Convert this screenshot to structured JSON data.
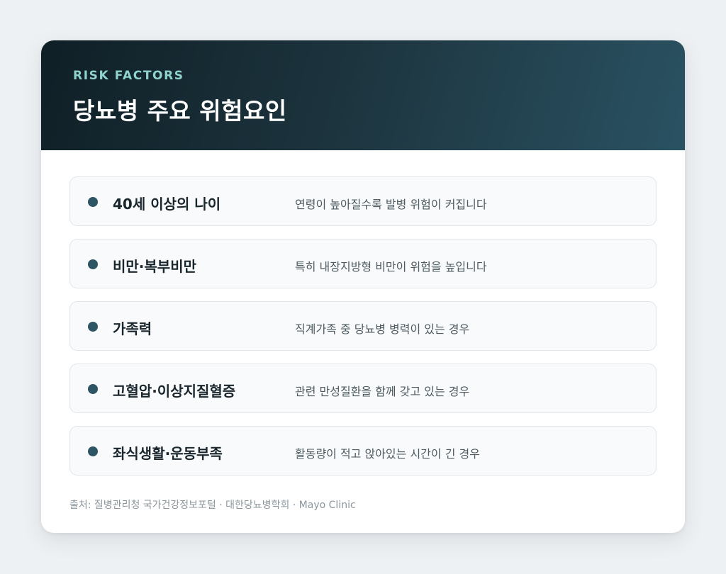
{
  "header": {
    "eyebrow": "RISK FACTORS",
    "title": "당뇨병 주요 위험요인"
  },
  "factors": [
    {
      "label": "40세 이상의 나이",
      "description": "연령이 높아질수록 발병 위험이 커집니다"
    },
    {
      "label": "비만·복부비만",
      "description": "특히 내장지방형 비만이 위험을 높입니다"
    },
    {
      "label": "가족력",
      "description": "직계가족 중 당뇨병 병력이 있는 경우"
    },
    {
      "label": "고혈압·이상지질혈증",
      "description": "관련 만성질환을 함께 갖고 있는 경우"
    },
    {
      "label": "좌식생활·운동부족",
      "description": "활동량이 적고 앉아있는 시간이 긴 경우"
    }
  ],
  "source": "출처: 질병관리청 국가건강정보포털 · 대한당뇨병학회 · Mayo Clinic",
  "colors": {
    "background": "#eef1f3",
    "header_dark": "#0f1f26",
    "header_light": "#2a5262",
    "eyebrow": "#8fd3cf",
    "bullet": "#2e5566"
  }
}
